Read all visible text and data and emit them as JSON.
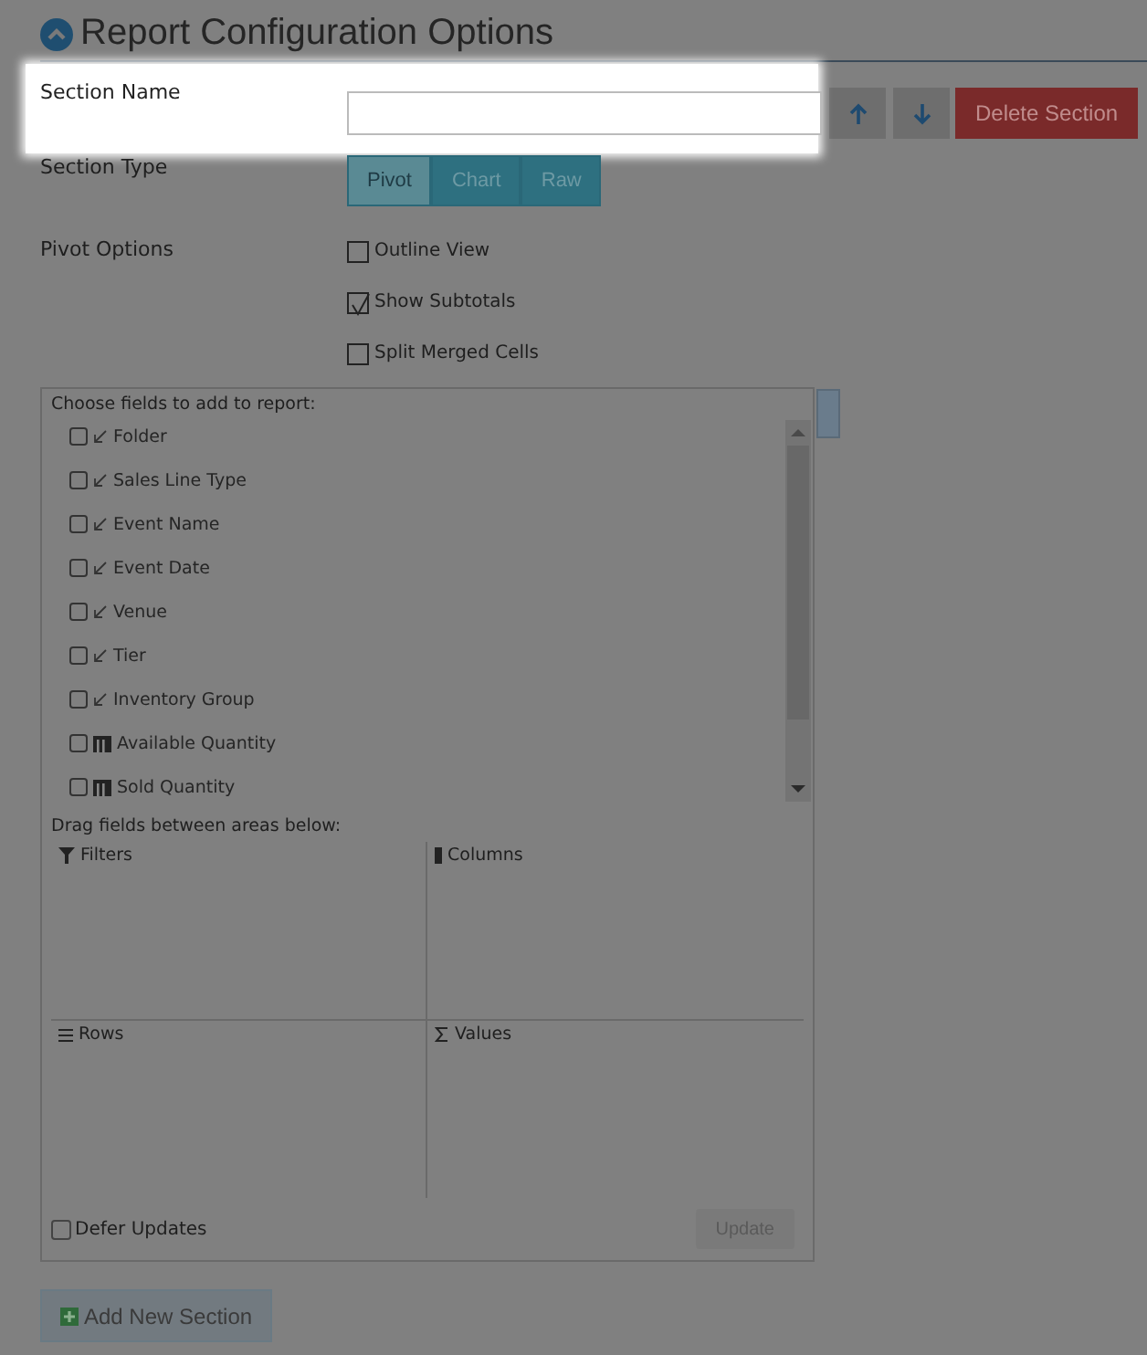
{
  "header": {
    "title": "Report Configuration Options",
    "expanded": true
  },
  "section_name": {
    "label": "Section Name",
    "highlighted": true
  },
  "move_buttons": [
    {
      "kind": "up"
    },
    {
      "kind": "down"
    }
  ],
  "delete_button": {
    "label": "Delete Section"
  },
  "section_type": {
    "label": "Section Type",
    "options": [
      {
        "label": "Pivot",
        "selected": true
      },
      {
        "label": "Chart",
        "selected": false
      },
      {
        "label": "Raw",
        "selected": false
      }
    ]
  },
  "pivot_options": {
    "label": "Pivot Options",
    "items": [
      {
        "label": "Outline View",
        "checked": false
      },
      {
        "label": "Show Subtotals",
        "checked": true
      },
      {
        "label": "Split Merged Cells",
        "checked": false
      }
    ]
  },
  "field_list": {
    "heading": "Choose fields to add to report:",
    "fields": [
      {
        "label": "Folder",
        "kind": "dimension",
        "checked": false
      },
      {
        "label": "Sales Line Type",
        "kind": "dimension",
        "checked": false
      },
      {
        "label": "Event Name",
        "kind": "dimension",
        "checked": false
      },
      {
        "label": "Event Date",
        "kind": "dimension",
        "checked": false
      },
      {
        "label": "Venue",
        "kind": "dimension",
        "checked": false
      },
      {
        "label": "Tier",
        "kind": "dimension",
        "checked": false
      },
      {
        "label": "Inventory Group",
        "kind": "dimension",
        "checked": false
      },
      {
        "label": "Available Quantity",
        "kind": "measure",
        "checked": false
      },
      {
        "label": "Sold Quantity",
        "kind": "measure",
        "checked": false
      }
    ]
  },
  "areas": {
    "heading": "Drag fields between areas below:",
    "items": [
      {
        "label": "Filters",
        "kind": "filter"
      },
      {
        "label": "Columns",
        "kind": "columns"
      },
      {
        "label": "Rows",
        "kind": "rows"
      },
      {
        "label": "Values",
        "kind": "values"
      }
    ]
  },
  "defer_updates": {
    "label": "Defer Updates",
    "checked": false
  },
  "update_button": {
    "label": "Update",
    "disabled": true
  },
  "add_button": {
    "label": "Add New Section"
  }
}
